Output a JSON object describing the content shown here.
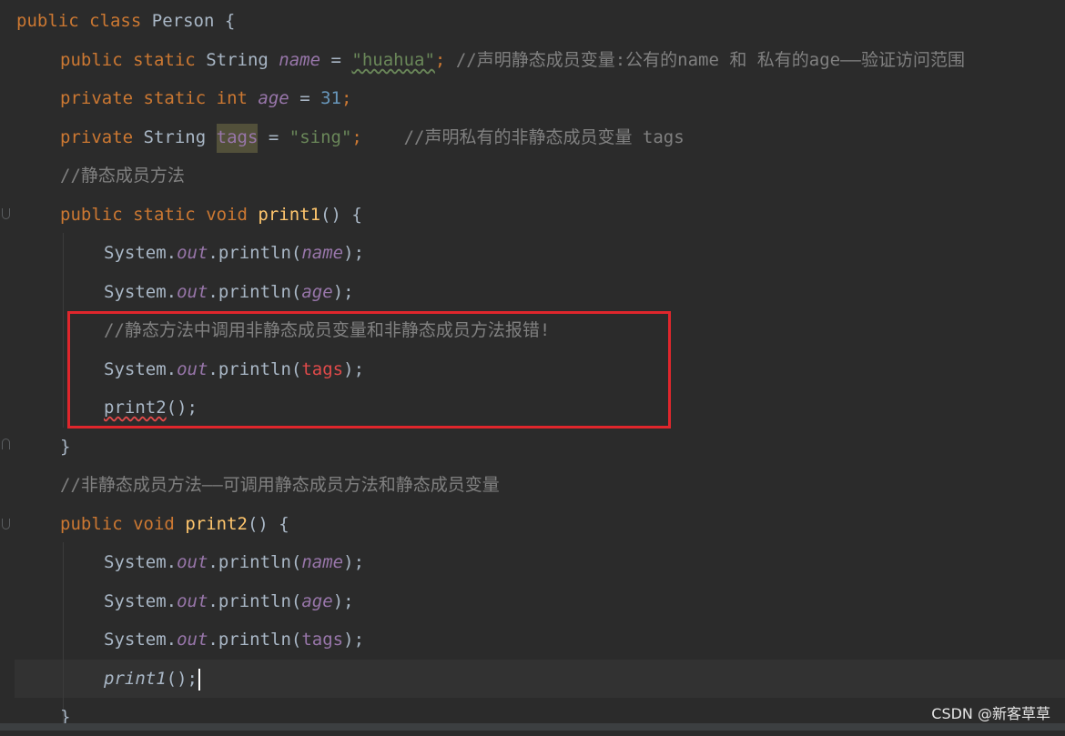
{
  "code": {
    "l1": [
      "public",
      "class",
      "Person",
      "{"
    ],
    "l2": [
      "public",
      "static",
      "String",
      "name",
      "=",
      "\"huahua\"",
      ";",
      "//声明静态成员变量:公有的name 和 私有的age——验证访问范围"
    ],
    "l3": [
      "private",
      "static",
      "int",
      "age",
      "=",
      "31",
      ";"
    ],
    "l4": [
      "private",
      "String",
      "tags",
      "=",
      "\"sing\"",
      ";",
      "//声明私有的非静态成员变量 tags"
    ],
    "l5": [
      "//静态成员方法"
    ],
    "l6": [
      "public",
      "static",
      "void",
      "print1",
      "() {"
    ],
    "l7": [
      "System.",
      "out",
      ".println(",
      "name",
      ");"
    ],
    "l8": [
      "System.",
      "out",
      ".println(",
      "age",
      ");"
    ],
    "l9": [
      "//静态方法中调用非静态成员变量和非静态成员方法报错!"
    ],
    "l10": [
      "System.",
      "out",
      ".println(",
      "tags",
      ");"
    ],
    "l11": [
      "print2",
      "();"
    ],
    "l12": [
      "}"
    ],
    "l13": [
      "//非静态成员方法——可调用静态成员方法和静态成员变量"
    ],
    "l14": [
      "public",
      "void",
      "print2",
      "() {"
    ],
    "l15": [
      "System.",
      "out",
      ".println(",
      "name",
      ");"
    ],
    "l16": [
      "System.",
      "out",
      ".println(",
      "age",
      ");"
    ],
    "l17": [
      "System.",
      "out",
      ".println(",
      "tags",
      ");"
    ],
    "l18": [
      "print1",
      "();"
    ],
    "l19": [
      "}"
    ]
  },
  "colors": {
    "keyword": "#cc7832",
    "string": "#6a8759",
    "number": "#6897bb",
    "field": "#9876aa",
    "method_decl": "#ffc66d",
    "comment": "#808080",
    "error": "#e04a4a",
    "highlight_frame": "#e0262c"
  },
  "watermark": "CSDN @新客草草"
}
